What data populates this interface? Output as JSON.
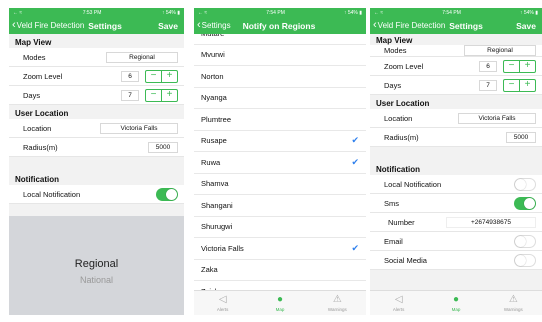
{
  "colors": {
    "accent": "#3cba54",
    "check": "#2f80ed"
  },
  "status": {
    "s1": {
      "left": "← ≈",
      "time": "7:53 PM",
      "right": "↑ 54% ▮"
    },
    "s2": {
      "left": "← ≈",
      "time": "7:54 PM",
      "right": "↑ 54% ▮"
    },
    "s3": {
      "left": "← ≈",
      "time": "7:54 PM",
      "right": "↑ 54% ▮"
    }
  },
  "screen1": {
    "back": "Veld Fire Detection",
    "title": "Settings",
    "save": "Save",
    "map_view": "Map View",
    "modes_label": "Modes",
    "modes_value": "Regional",
    "zoom_label": "Zoom Level",
    "zoom_value": "6",
    "days_label": "Days",
    "days_value": "7",
    "minus": "−",
    "plus": "+",
    "user_location": "User Location",
    "location_label": "Location",
    "location_value": "Victoria Falls",
    "radius_label": "Radius(m)",
    "radius_value": "5000",
    "notification": "Notification",
    "local_notification": "Local Notification",
    "local_notification_on": true,
    "picker_selected": "Regional",
    "picker_next": "National"
  },
  "screen2": {
    "back": "Settings",
    "title": "Notify on Regions",
    "regions": [
      {
        "name": "Mutare",
        "checked": false
      },
      {
        "name": "Mvurwi",
        "checked": false
      },
      {
        "name": "Norton",
        "checked": false
      },
      {
        "name": "Nyanga",
        "checked": false
      },
      {
        "name": "Plumtree",
        "checked": false
      },
      {
        "name": "Rusape",
        "checked": true
      },
      {
        "name": "Ruwa",
        "checked": true
      },
      {
        "name": "Shamva",
        "checked": false
      },
      {
        "name": "Shangani",
        "checked": false
      },
      {
        "name": "Shurugwi",
        "checked": false
      },
      {
        "name": "Victoria Falls",
        "checked": true
      },
      {
        "name": "Zaka",
        "checked": false
      },
      {
        "name": "Zvishavane",
        "checked": false
      }
    ],
    "check_glyph": "✔",
    "tabs": [
      {
        "label": "Alerts",
        "icon": "◁",
        "icon_name": "send-icon"
      },
      {
        "label": "Map",
        "icon": "●",
        "icon_name": "map-pin-icon"
      },
      {
        "label": "Warnings",
        "icon": "⚠",
        "icon_name": "warning-icon"
      }
    ]
  },
  "screen3": {
    "back": "Veld Fire Detection",
    "title": "Settings",
    "save": "Save",
    "map_view": "Map View",
    "modes_label": "Modes",
    "modes_value": "Regional",
    "zoom_label": "Zoom Level",
    "zoom_value": "6",
    "days_label": "Days",
    "days_value": "7",
    "minus": "−",
    "plus": "+",
    "user_location": "User Location",
    "location_label": "Location",
    "location_value": "Victoria Falls",
    "radius_label": "Radius(m)",
    "radius_value": "5000",
    "notification": "Notification",
    "local_notification": "Local Notification",
    "local_notification_on": false,
    "sms_label": "Sms",
    "sms_on": true,
    "number_label": "Number",
    "number_value": "+2674938675",
    "email_label": "Email",
    "email_on": false,
    "social_label": "Social Media",
    "social_on": false
  }
}
